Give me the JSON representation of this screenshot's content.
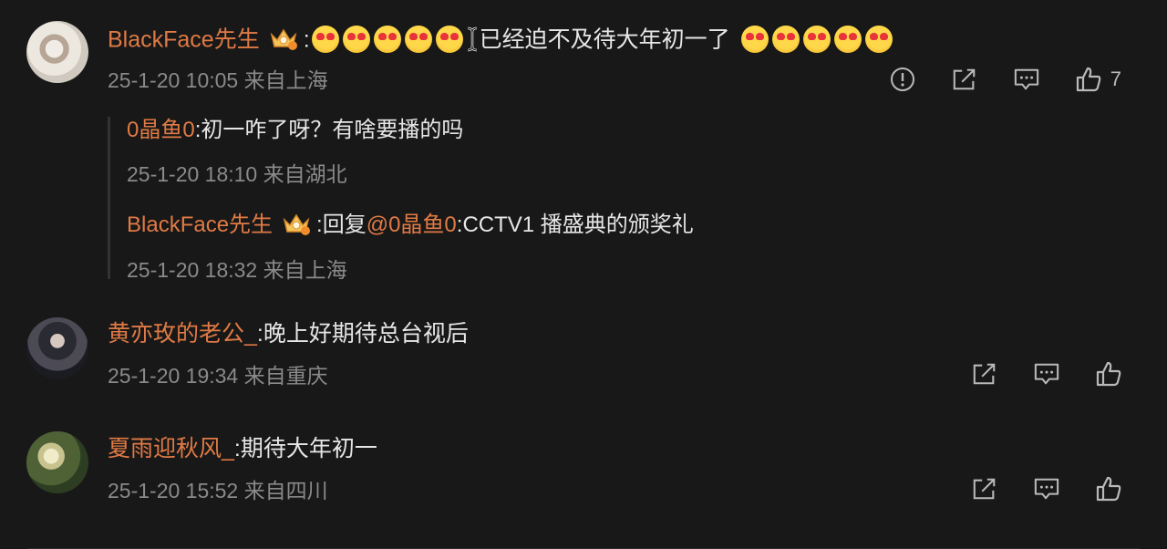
{
  "comments": [
    {
      "username": "BlackFace先生",
      "colon": ":",
      "text": "已经迫不及待大年初一了",
      "meta": "25-1-20 10:05 来自上海",
      "like_count": "7",
      "replies": [
        {
          "username": "0晶鱼0",
          "text": ":初一咋了呀？有啥要播的吗",
          "meta": "25-1-20 18:10 来自湖北"
        },
        {
          "username": "BlackFace先生",
          "prefix": ":回复",
          "mention": "@0晶鱼0",
          "text": ":CCTV1 播盛典的颁奖礼",
          "meta": "25-1-20 18:32 来自上海"
        }
      ]
    },
    {
      "username": "黄亦玫的老公_",
      "text": ":晚上好期待总台视后",
      "meta": "25-1-20 19:34 来自重庆"
    },
    {
      "username": "夏雨迎秋风_",
      "text": ":期待大年初一",
      "meta": "25-1-20 15:52 来自四川"
    }
  ],
  "icons": {
    "report": "report-icon",
    "share": "share-icon",
    "comment": "comment-icon",
    "like": "thumbs-up-icon",
    "badge": "crown-badge-icon",
    "emoji": "heart-eyes-emoji"
  },
  "colors": {
    "username": "#e07a45",
    "background": "#181818",
    "meta": "#8a8a8a"
  }
}
